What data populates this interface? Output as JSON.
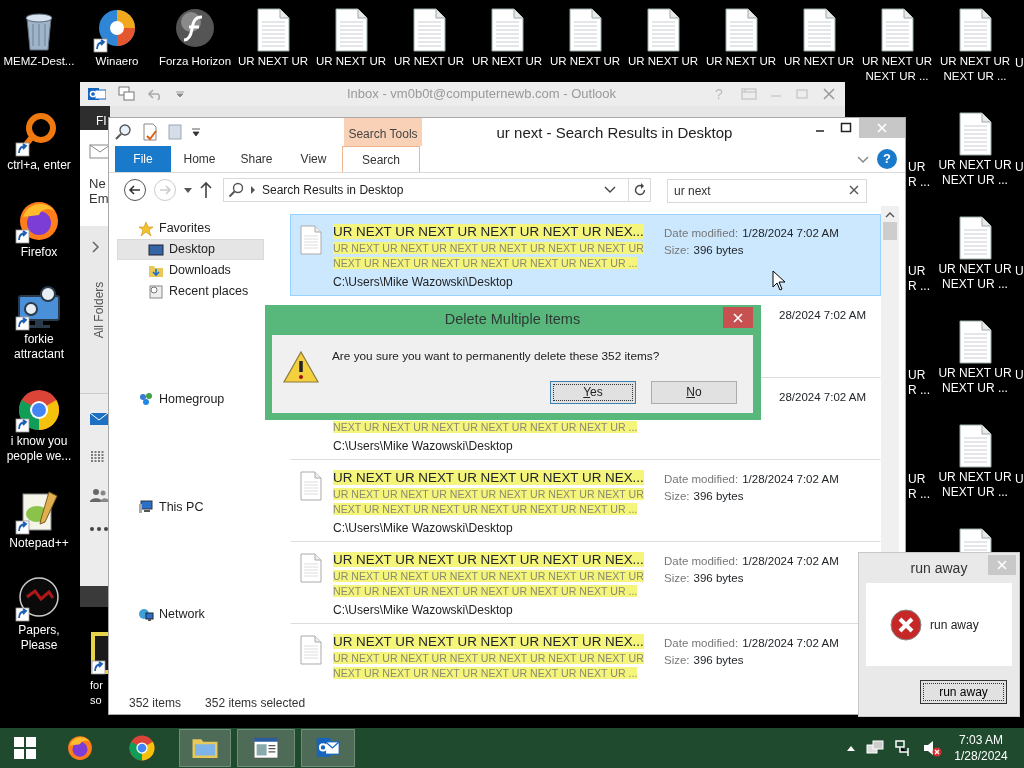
{
  "desktop": {
    "top_row": [
      {
        "kind": "recycle-bin",
        "label": "MEMZ-Dest...",
        "shortcut": false
      },
      {
        "kind": "swirl",
        "label": "Winaero",
        "shortcut": true
      },
      {
        "kind": "sphere",
        "label": "Forza Horizon",
        "shortcut": false
      },
      {
        "kind": "document",
        "label": "UR NEXT UR",
        "shortcut": false
      },
      {
        "kind": "document",
        "label": "UR NEXT UR",
        "shortcut": false
      },
      {
        "kind": "document",
        "label": "UR NEXT UR",
        "shortcut": false
      },
      {
        "kind": "document",
        "label": "UR NEXT UR",
        "shortcut": false
      },
      {
        "kind": "document",
        "label": "UR NEXT UR",
        "shortcut": false
      },
      {
        "kind": "document",
        "label": "UR NEXT UR",
        "shortcut": false
      },
      {
        "kind": "document",
        "label": "UR NEXT UR",
        "shortcut": false
      },
      {
        "kind": "document",
        "label": "UR NEXT UR",
        "shortcut": false
      },
      {
        "kind": "document",
        "label": "UR NEXT UR NEXT UR ...",
        "shortcut": false
      },
      {
        "kind": "document",
        "label": "UR NEXT UR NEXT UR ...",
        "shortcut": false
      }
    ],
    "left_column": [
      {
        "kind": "ring",
        "label": "ctrl+a, enter",
        "shortcut": true
      },
      {
        "kind": "fox",
        "label": "Firefox",
        "shortcut": true
      },
      {
        "kind": "monitor",
        "label": "forkie attractant",
        "shortcut": true
      },
      {
        "kind": "chrome",
        "label": "i know you people we...",
        "shortcut": true
      },
      {
        "kind": "notepad",
        "label": "Notepad++",
        "shortcut": true
      },
      {
        "kind": "emblem",
        "label": "Papers, Please",
        "shortcut": true
      }
    ],
    "second_column": [
      {
        "kind": "frame",
        "label": "for\nso",
        "shortcut": true
      }
    ],
    "right_column": [
      {
        "kind": "document",
        "label": "UR NEXT UR NEXT UR ...",
        "shortcut": false
      },
      {
        "kind": "document",
        "label": "UR NEXT UR NEXT UR ...",
        "shortcut": false
      },
      {
        "kind": "document",
        "label": "UR NEXT UR NEXT UR ...",
        "shortcut": false
      },
      {
        "kind": "document",
        "label": "UR NEXT UR NEXT UR ...",
        "shortcut": false
      },
      {
        "kind": "document"
      }
    ],
    "edge_fragments": [
      "UR\nR ...",
      "UR\nR ...",
      "UR\nR ...",
      "UR\nR ..."
    ],
    "far_right_fragments": [
      "U",
      "U",
      "U",
      "U",
      "U"
    ]
  },
  "outlook": {
    "title": "Inbox - vm0b0t@computernewb.com - Outlook",
    "help": "?",
    "file_tab": "FI",
    "new_email": "Ne\nEm",
    "folders_label": "All Folders"
  },
  "explorer": {
    "title": "ur next - Search Results in Desktop",
    "context_tab": "Search Tools",
    "tabs": [
      {
        "label": "File",
        "kind": "file",
        "selected": false
      },
      {
        "label": "Home",
        "kind": "plain",
        "selected": false
      },
      {
        "label": "Share",
        "kind": "plain",
        "selected": false
      },
      {
        "label": "View",
        "kind": "plain",
        "selected": false
      },
      {
        "label": "Search",
        "kind": "context",
        "selected": true
      }
    ],
    "help": "?",
    "address": "Search Results in Desktop",
    "search": {
      "value": "ur next"
    },
    "nav": [
      {
        "label": "Favorites",
        "selected": false,
        "children": [
          {
            "label": "Desktop",
            "selected": true
          },
          {
            "label": "Downloads",
            "selected": false
          },
          {
            "label": "Recent places",
            "selected": false
          }
        ]
      },
      {
        "label": "Homegroup",
        "selected": false
      },
      {
        "label": "This PC",
        "selected": false
      },
      {
        "label": "Network",
        "selected": false
      }
    ],
    "results": [
      {
        "selected": true,
        "title": "UR NEXT UR NEXT UR NEXT UR NEXT UR NEX...",
        "preview_1": "UR NEXT UR NEXT UR NEXT UR NEXT UR NEXT UR NEXT UR",
        "preview_2": "NEXT UR NEXT UR NEXT UR NEXT UR NEXT UR NEXT UR ...",
        "path": "C:\\Users\\Mike Wazowski\\Desktop",
        "date_label": "Date modified:",
        "date": "1/28/2024 7:02 AM",
        "size_label": "Size:",
        "size": "396 bytes"
      },
      {
        "selected": false,
        "date": "28/2024 7:02 AM"
      },
      {
        "selected": false,
        "preview_2": "NEXT UR NEXT UR NEXT UR NEXT UR NEXT UR NEXT UR ...",
        "path": "C:\\Users\\Mike Wazowski\\Desktop",
        "date": "28/2024 7:02 AM"
      },
      {
        "selected": false,
        "title": "UR NEXT UR NEXT UR NEXT UR NEXT UR NEX...",
        "preview_1": "UR NEXT UR NEXT UR NEXT UR NEXT UR NEXT UR NEXT UR",
        "preview_2": "NEXT UR NEXT UR NEXT UR NEXT UR NEXT UR NEXT UR ...",
        "path": "C:\\Users\\Mike Wazowski\\Desktop",
        "date_label": "Date modified:",
        "date": "1/28/2024 7:02 AM",
        "size_label": "Size:",
        "size": "396 bytes"
      },
      {
        "selected": false,
        "title": "UR NEXT UR NEXT UR NEXT UR NEXT UR NEX...",
        "preview_1": "UR NEXT UR NEXT UR NEXT UR NEXT UR NEXT UR NEXT UR",
        "preview_2": "NEXT UR NEXT UR NEXT UR NEXT UR NEXT UR NEXT UR ...",
        "path": "C:\\Users\\Mike Wazowski\\Desktop",
        "date_label": "Date modified:",
        "date": "1/28/2024 7:02 AM",
        "size_label": "Size:",
        "size": "396 bytes"
      },
      {
        "selected": false,
        "title": "UR NEXT UR NEXT UR NEXT UR NEXT UR NEX...",
        "preview_1": "UR NEXT UR NEXT UR NEXT UR NEXT UR NEXT UR NEXT UR",
        "preview_2": "NEXT UR NEXT UR NEXT UR NEXT UR NEXT UR NEXT UR ...",
        "date_label": "Date modified:",
        "date": "1/28/2024 7:02 AM",
        "size_label": "Size:",
        "size": "396 bytes"
      }
    ],
    "status": {
      "count": "352 items",
      "selection": "352 items selected"
    }
  },
  "delete_dialog": {
    "title": "Delete Multiple Items",
    "message": "Are you sure you want to permanently delete these 352 items?",
    "buttons": [
      {
        "label": "Yes",
        "focused": true
      },
      {
        "label": "No",
        "focused": false
      }
    ]
  },
  "run_away_dialog": {
    "title": "run away",
    "message": "run away",
    "button": "run away"
  },
  "taskbar": {
    "apps": [
      {
        "kind": "fox",
        "open": false
      },
      {
        "kind": "chrome",
        "open": false
      },
      {
        "kind": "folder",
        "open": true
      },
      {
        "kind": "window",
        "open": true
      },
      {
        "kind": "mail",
        "open": true
      }
    ],
    "volume_muted": true,
    "time": "7:03 AM",
    "date": "1/28/2024"
  }
}
